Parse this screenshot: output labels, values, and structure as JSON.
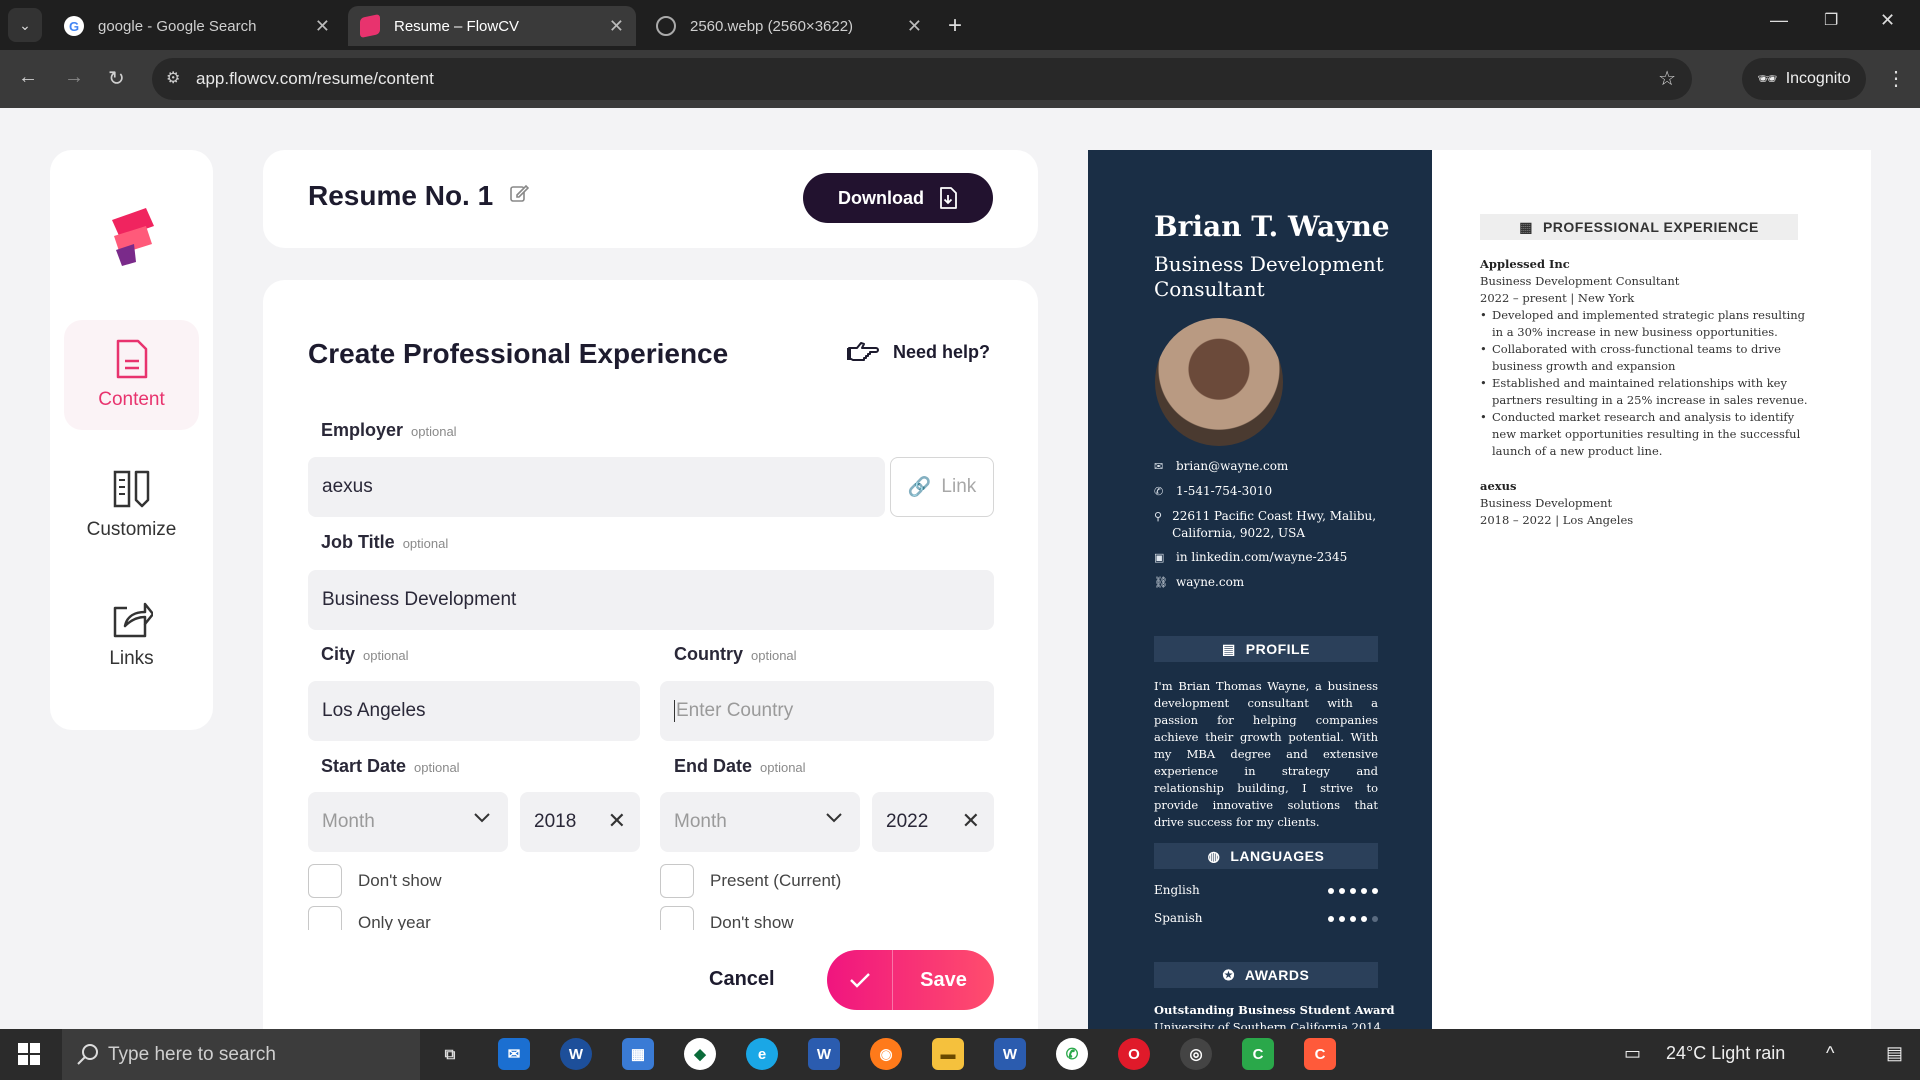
{
  "browser": {
    "tabs": [
      {
        "title": "google - Google Search",
        "icon": "google-icon"
      },
      {
        "title": "Resume – FlowCV",
        "icon": "flowcv-icon"
      },
      {
        "title": "2560.webp (2560×3622)",
        "icon": "globe-icon"
      }
    ],
    "url": "app.flowcv.com/resume/content",
    "incognito_label": "Incognito"
  },
  "sidebar": {
    "items": [
      {
        "label": "Content",
        "icon": "document-icon"
      },
      {
        "label": "Customize",
        "icon": "customize-icon"
      },
      {
        "label": "Links",
        "icon": "share-icon"
      }
    ]
  },
  "header": {
    "title": "Resume No. 1",
    "download_label": "Download"
  },
  "form": {
    "title": "Create Professional Experience",
    "help_label": "Need help?",
    "optional": "optional",
    "employer": {
      "label": "Employer",
      "value": "aexus",
      "link_label": "Link"
    },
    "job_title": {
      "label": "Job Title",
      "value": "Business Development"
    },
    "city": {
      "label": "City",
      "value": "Los Angeles"
    },
    "country": {
      "label": "Country",
      "placeholder": "Enter Country"
    },
    "start_date": {
      "label": "Start Date",
      "month": "Month",
      "year": "2018"
    },
    "end_date": {
      "label": "End Date",
      "month": "Month",
      "year": "2022"
    },
    "checks": {
      "dont_show": "Don't show",
      "only_year": "Only year",
      "present": "Present (Current)",
      "dont_show_end": "Don't show"
    },
    "cancel_label": "Cancel",
    "save_label": "Save"
  },
  "resume": {
    "name": "Brian T. Wayne",
    "role": "Business Development Consultant",
    "contacts": [
      {
        "icon": "email-icon",
        "text": "brian@wayne.com"
      },
      {
        "icon": "phone-icon",
        "text": "1-541-754-3010"
      },
      {
        "icon": "location-icon",
        "text": "22611 Pacific Coast Hwy, Malibu, California, 9022, USA"
      },
      {
        "icon": "linkedin-icon",
        "text": "in linkedin.com/wayne-2345"
      },
      {
        "icon": "link-icon",
        "text": "wayne.com"
      }
    ],
    "profile_title": "PROFILE",
    "profile_text": "I'm Brian Thomas Wayne, a business development consultant with a passion for helping companies achieve their growth potential. With my MBA degree and extensive experience in strategy and relationship building, I strive to provide innovative solutions that drive success for my clients.",
    "languages_title": "LANGUAGES",
    "languages": [
      {
        "name": "English",
        "level": 5,
        "max": 5
      },
      {
        "name": "Spanish",
        "level": 4,
        "max": 5
      }
    ],
    "awards_title": "AWARDS",
    "award_name": "Outstanding Business Student Award",
    "award_detail": "University of Southern California 2014",
    "experience_title": "PROFESSIONAL EXPERIENCE",
    "jobs": [
      {
        "employer": "Applessed Inc",
        "title": "Business Development Consultant",
        "dates": "2022 – present | New York",
        "bullets": [
          "Developed and implemented strategic plans resulting in a 30% increase in new business opportunities.",
          "Collaborated with cross-functional teams to drive business growth and expansion",
          "Established and maintained relationships with key partners resulting in a 25% increase in sales revenue.",
          "Conducted market research and analysis to identify new market opportunities resulting in the successful launch of a new product line."
        ]
      },
      {
        "employer": "aexus",
        "title": "Business Development",
        "dates": "2018 – 2022 | Los Angeles",
        "bullets": []
      }
    ]
  },
  "taskbar": {
    "search_placeholder": "Type here to search",
    "weather": "24°C  Light rain"
  },
  "colors": {
    "accent": "#e8336e",
    "dark": "#22122f",
    "resume_sidebar": "#1a2e45"
  }
}
